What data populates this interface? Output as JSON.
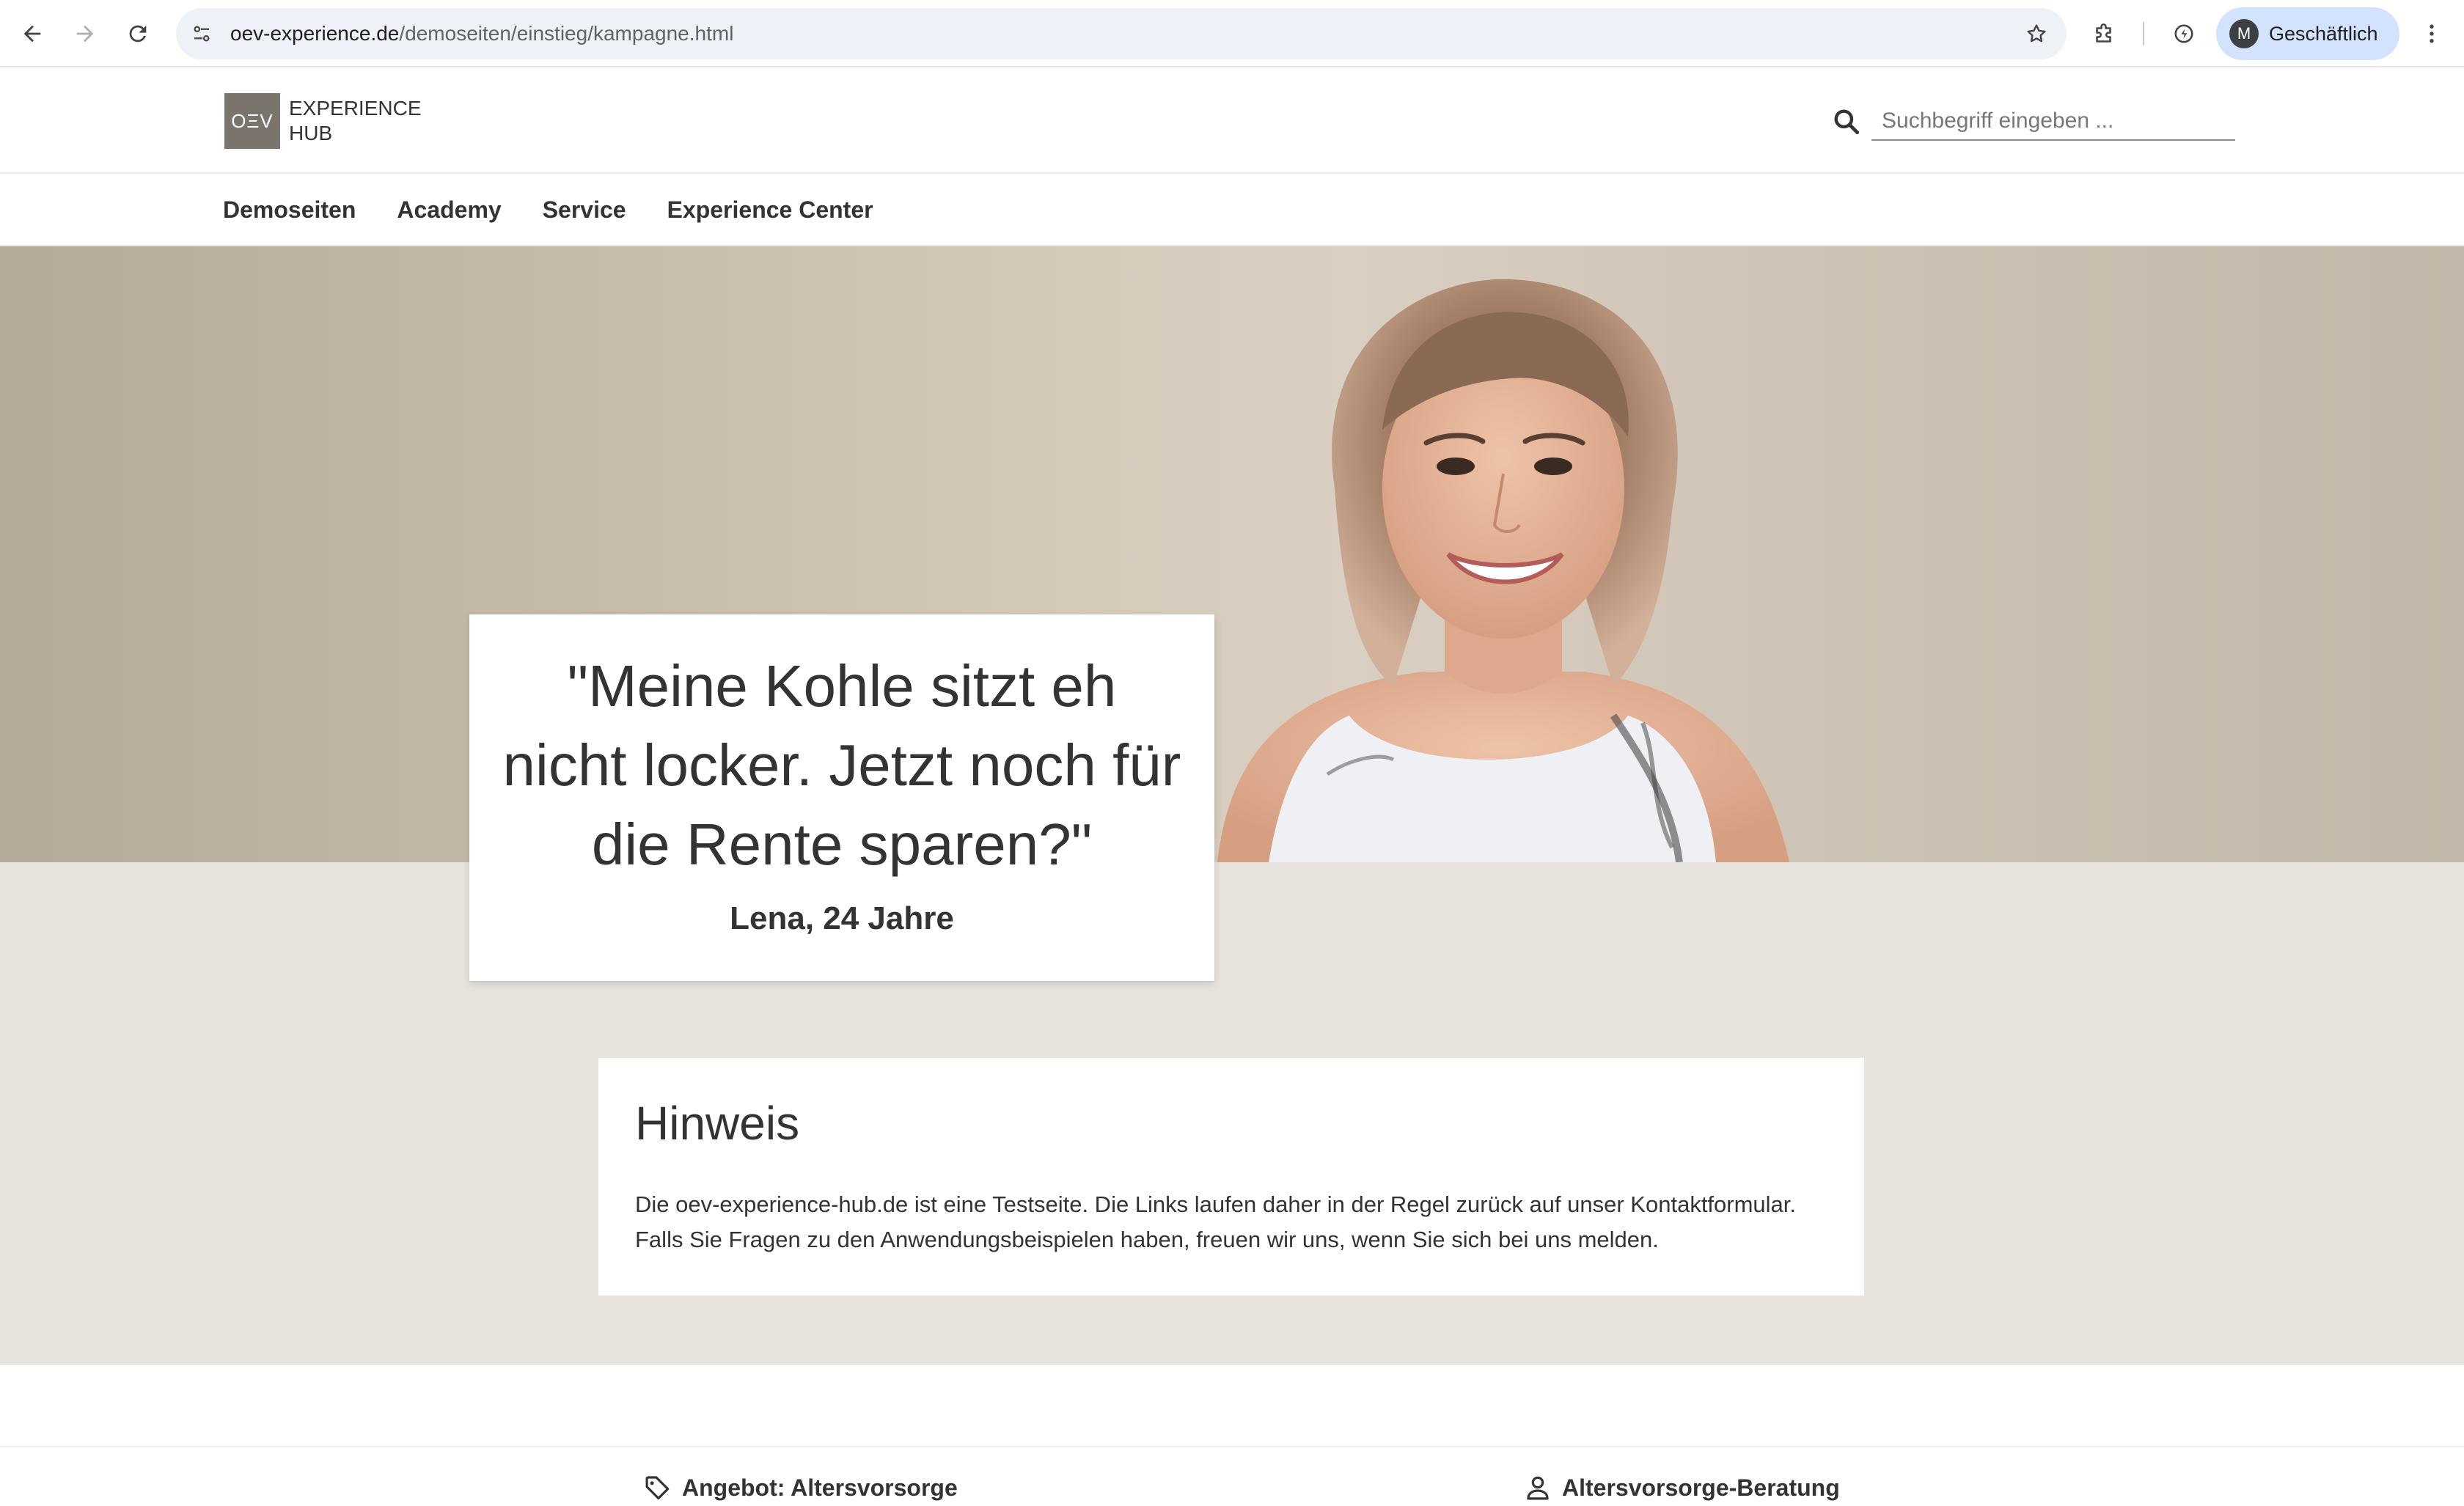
{
  "browser": {
    "url_host": "oev-experience.de",
    "url_path": "/demoseiten/einstieg/kampagne.html",
    "profile_initial": "M",
    "profile_label": "Geschäftlich",
    "icons": [
      "back-arrow-icon",
      "forward-arrow-icon",
      "reload-icon",
      "site-settings-icon",
      "bookmark-star-icon",
      "extensions-puzzle-icon",
      "chrome-labs-icon",
      "more-vert-icon"
    ]
  },
  "header": {
    "logo_mark": "OΞV",
    "logo_line1": "EXPERIENCE",
    "logo_line2": "HUB",
    "search_placeholder": "Suchbegriff eingeben ..."
  },
  "nav": {
    "items": [
      {
        "label": "Demoseiten"
      },
      {
        "label": "Academy"
      },
      {
        "label": "Service"
      },
      {
        "label": "Experience Center"
      }
    ]
  },
  "hero": {
    "quote": "\"Meine Kohle sitzt eh nicht locker. Jetzt noch für die Rente sparen?\"",
    "author": "Lena, 24 Jahre"
  },
  "notice": {
    "title": "Hinweis",
    "body": "Die oev-experience-hub.de ist eine Testseite. Die Links laufen daher in der Regel zurück auf unser Kontaktformular. Falls Sie Fragen zu den Anwendungsbeispielen haben, freuen wir uns, wenn Sie sich bei uns melden."
  },
  "teasers": [
    {
      "label": "Angebot: Altersvorsorge",
      "icon": "tag-icon"
    },
    {
      "label": "Altersvorsorge-Beratung",
      "icon": "person-icon"
    }
  ],
  "colors": {
    "hero_background": "#c7bcac",
    "section_background": "#e8e3dd",
    "logo_box": "#7a746c",
    "omnibox": "#eef1f8",
    "profile_chip": "#d3e3fd"
  }
}
